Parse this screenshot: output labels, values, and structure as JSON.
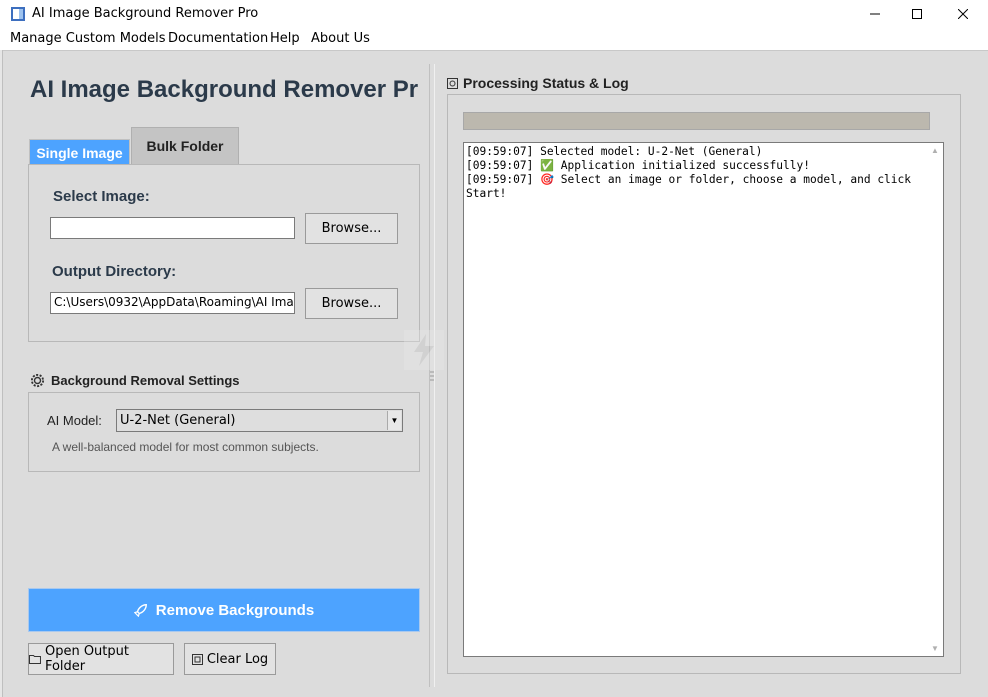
{
  "window": {
    "title": "AI Image Background Remover Pro",
    "minimize_glyph": "—",
    "maximize_glyph": "☐",
    "close_glyph": "✕"
  },
  "menu": {
    "items": [
      "Manage Custom Models",
      "Documentation",
      "Help",
      "About Us"
    ]
  },
  "app": {
    "heading": "AI Image Background Remover Pr"
  },
  "tabs": {
    "single": "Single Image",
    "bulk": "Bulk Folder",
    "active": "single"
  },
  "single_image": {
    "select_label": "Select Image:",
    "select_value": "",
    "output_label": "Output Directory:",
    "output_value": "C:\\Users\\0932\\AppData\\Roaming\\AI Ima",
    "browse_label": "Browse..."
  },
  "settings": {
    "title": "Background Removal Settings",
    "model_label": "AI Model:",
    "model_value": "U-2-Net (General)",
    "model_description": "A well-balanced model for most common subjects."
  },
  "actions": {
    "remove": "Remove Backgrounds",
    "open_output": "Open Output Folder",
    "clear_log": "Clear Log"
  },
  "log": {
    "title": "Processing Status & Log",
    "progress_fraction": 1.0,
    "text": "[09:59:07] Selected model: U-2-Net (General)\n[09:59:07] ✅ Application initialized successfully!\n[09:59:07] 🎯 Select an image or folder, choose a model, and click Start!"
  },
  "colors": {
    "accent": "#4da3ff",
    "background": "#dcdcdc",
    "heading": "#2b3a4a",
    "progress": "#bcb8ae"
  }
}
